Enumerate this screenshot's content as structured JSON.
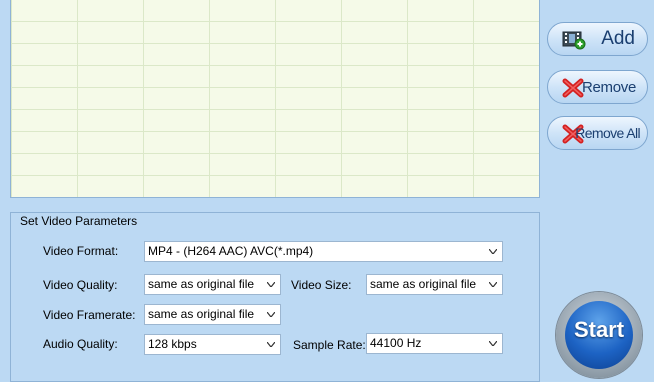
{
  "side_buttons": {
    "add": "Add",
    "remove": "Remove",
    "remove_all": "Remove All"
  },
  "params": {
    "title": "Set Video Parameters",
    "video_format": {
      "label": "Video Format:",
      "value": "MP4 - (H264 AAC) AVC(*.mp4)"
    },
    "video_quality": {
      "label": "Video Quality:",
      "value": "same as original file"
    },
    "video_size": {
      "label": "Video Size:",
      "value": "same as original file"
    },
    "video_framerate": {
      "label": "Video Framerate:",
      "value": "same as original file"
    },
    "audio_quality": {
      "label": "Audio Quality:",
      "value": "128 kbps"
    },
    "sample_rate": {
      "label": "Sample Rate:",
      "value": "44100 Hz"
    }
  },
  "start": {
    "label": "Start"
  },
  "icons": {
    "add": "film-add-icon",
    "remove": "red-x-icon",
    "remove_all": "red-x-icon",
    "dropdown": "chevron-down-icon"
  },
  "colors": {
    "background": "#bcd9f3",
    "list_background": "#f5fae8",
    "accent_blue": "#1d63c4",
    "remove_red": "#d42020"
  }
}
